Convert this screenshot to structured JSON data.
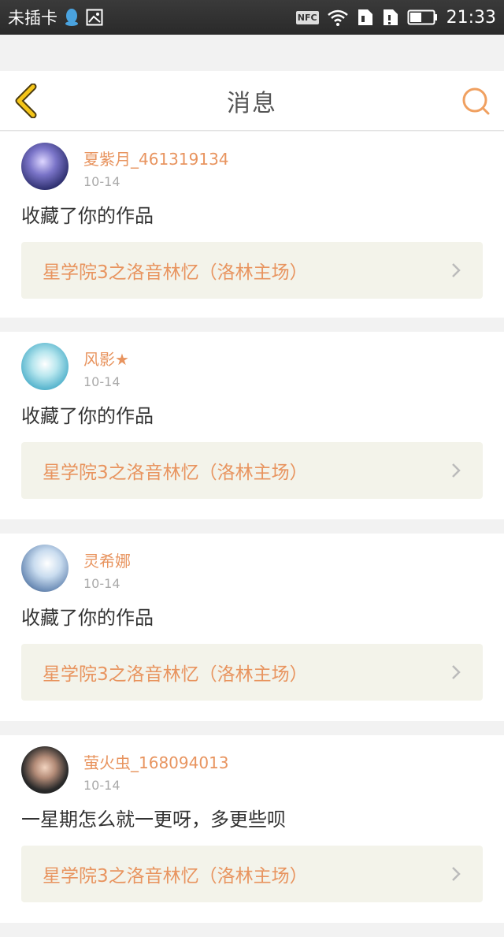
{
  "status_bar": {
    "carrier": "未插卡",
    "nfc": "NFC",
    "time": "21:33"
  },
  "header": {
    "title": "消息"
  },
  "messages": [
    {
      "username": "夏紫月_461319134",
      "date": "10-14",
      "comment": "收藏了你的作品",
      "work_title": "星学院3之洛音林忆（洛林主场）"
    },
    {
      "username": "风影★",
      "date": "10-14",
      "comment": "收藏了你的作品",
      "work_title": "星学院3之洛音林忆（洛林主场）"
    },
    {
      "username": "灵希娜",
      "date": "10-14",
      "comment": "收藏了你的作品",
      "work_title": "星学院3之洛音林忆（洛林主场）"
    },
    {
      "username": "萤火虫_168094013",
      "date": "10-14",
      "comment": "一星期怎么就一更呀，多更些呗",
      "work_title": "星学院3之洛音林忆（洛林主场）"
    }
  ],
  "colors": {
    "accent": "#e8945f",
    "back_icon": "#f5c518"
  }
}
